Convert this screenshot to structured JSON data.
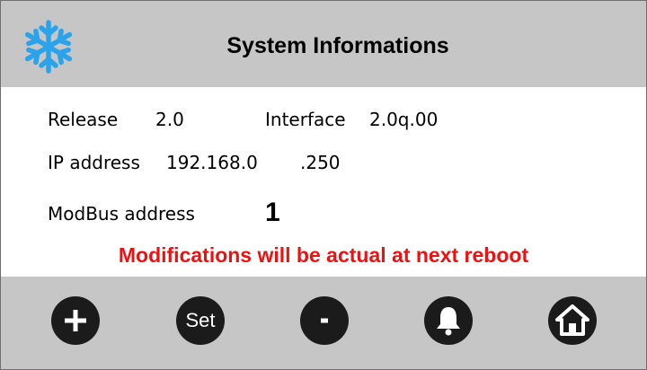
{
  "header": {
    "title": "System Informations",
    "icon": "snowflake-icon",
    "icon_color": "#2aa3ea"
  },
  "info": {
    "release_label": "Release",
    "release_value": "2.0",
    "interface_label": "Interface",
    "interface_value": "2.0q.00",
    "ip_label": "IP address",
    "ip_value_main": "192.168.0",
    "ip_value_last": ".250",
    "modbus_label": "ModBus address",
    "modbus_value": "1"
  },
  "warning": {
    "text": "Modifications will be actual at next reboot",
    "color": "#ee1111"
  },
  "footer": {
    "buttons": [
      {
        "icon": "plus-icon"
      },
      {
        "icon": "set-icon",
        "label": "Set"
      },
      {
        "icon": "minus-icon"
      },
      {
        "icon": "bell-icon"
      },
      {
        "icon": "home-icon"
      }
    ]
  }
}
